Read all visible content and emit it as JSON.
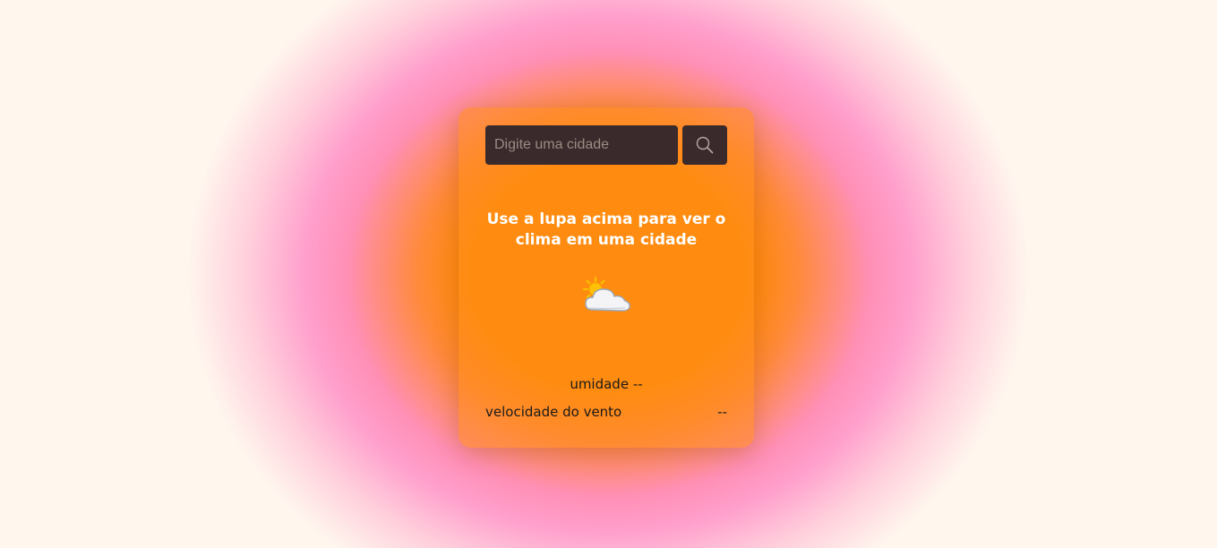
{
  "search": {
    "placeholder": "Digite uma cidade",
    "value": "",
    "button_icon": "search-icon"
  },
  "message": "Use a lupa acima para ver o clima em uma cidade",
  "weather_icon": "sun-behind-cloud-icon",
  "humidity": {
    "label": "umidade",
    "value": "--"
  },
  "wind": {
    "label": "velocidade do vento",
    "value": "--"
  },
  "colors": {
    "card_accent": "#ff8c00",
    "background_pink": "#ff8fc8",
    "background_cream": "#fff6ee",
    "input_bg": "#3a2a2c"
  }
}
